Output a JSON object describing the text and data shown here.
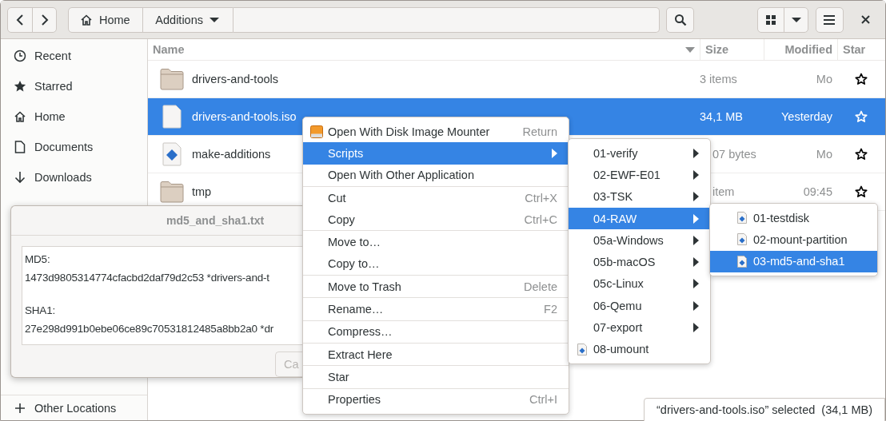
{
  "toolbar": {
    "path": [
      {
        "label": "Home",
        "kind": "home"
      },
      {
        "label": "Additions",
        "kind": "current"
      }
    ]
  },
  "sidebar": {
    "items": [
      {
        "label": "Recent"
      },
      {
        "label": "Starred"
      },
      {
        "label": "Home"
      },
      {
        "label": "Documents"
      },
      {
        "label": "Downloads"
      }
    ],
    "footer": {
      "label": "Other Locations"
    }
  },
  "table": {
    "columns": [
      "Name",
      "Size",
      "Modified",
      "Star"
    ],
    "rows": [
      {
        "name": "drivers-and-tools",
        "kind": "folder",
        "size": "3 items",
        "modified": "Mo",
        "selected": false
      },
      {
        "name": "drivers-and-tools.iso",
        "kind": "file",
        "size": "34,1 MB",
        "modified": "Yesterday",
        "selected": true
      },
      {
        "name": "make-additions",
        "kind": "script",
        "size": "07 bytes",
        "modified": "Mo",
        "selected": false
      },
      {
        "name": "tmp",
        "kind": "folder",
        "size": "item",
        "modified": "09:45",
        "selected": false
      }
    ]
  },
  "dialog": {
    "title": "md5_and_sha1.txt",
    "blocks": [
      {
        "label": "MD5:",
        "value": "1473d9805314774cfacbd2daf79d2c53 *drivers-and-t"
      },
      {
        "label": "SHA1:",
        "value": "27e298d991b0ebe06ce89c70531812485a8bb2a0 *dr"
      }
    ],
    "button": "Ca"
  },
  "context_menu": {
    "groups": [
      [
        {
          "label": "Open With Disk Image Mounter",
          "shortcut": "Return",
          "kind": "app",
          "selected": false
        },
        {
          "label": "Scripts",
          "kind": "submenu",
          "selected": true
        },
        {
          "label": "Open With Other Application",
          "kind": "plain",
          "selected": false
        }
      ],
      [
        {
          "label": "Cut",
          "shortcut": "Ctrl+X",
          "kind": "plain",
          "selected": false
        },
        {
          "label": "Copy",
          "shortcut": "Ctrl+C",
          "kind": "plain",
          "selected": false
        }
      ],
      [
        {
          "label": "Move to…",
          "kind": "plain",
          "selected": false
        },
        {
          "label": "Copy to…",
          "kind": "plain",
          "selected": false
        }
      ],
      [
        {
          "label": "Move to Trash",
          "shortcut": "Delete",
          "kind": "plain",
          "selected": false
        }
      ],
      [
        {
          "label": "Rename…",
          "shortcut": "F2",
          "kind": "plain",
          "selected": false
        }
      ],
      [
        {
          "label": "Compress…",
          "kind": "plain",
          "selected": false
        }
      ],
      [
        {
          "label": "Extract Here",
          "kind": "plain",
          "selected": false
        }
      ],
      [
        {
          "label": "Star",
          "kind": "plain",
          "selected": false
        }
      ],
      [
        {
          "label": "Properties",
          "shortcut": "Ctrl+I",
          "kind": "plain",
          "selected": false
        }
      ]
    ]
  },
  "scripts_menu": {
    "groups": [
      [
        {
          "label": "01-verify",
          "kind": "submenu",
          "selected": false
        },
        {
          "label": "02-EWF-E01",
          "kind": "submenu",
          "selected": false
        },
        {
          "label": "03-TSK",
          "kind": "submenu",
          "selected": false
        },
        {
          "label": "04-RAW",
          "kind": "submenu",
          "selected": true
        },
        {
          "label": "05a-Windows",
          "kind": "submenu",
          "selected": false
        },
        {
          "label": "05b-macOS",
          "kind": "submenu",
          "selected": false
        },
        {
          "label": "05c-Linux",
          "kind": "submenu",
          "selected": false
        },
        {
          "label": "06-Qemu",
          "kind": "submenu",
          "selected": false
        },
        {
          "label": "07-export",
          "kind": "submenu",
          "selected": false
        },
        {
          "label": "08-umount",
          "kind": "script",
          "selected": false
        }
      ]
    ]
  },
  "raw_menu": {
    "groups": [
      [
        {
          "label": "01-testdisk",
          "kind": "script",
          "selected": false
        },
        {
          "label": "02-mount-partition",
          "kind": "script",
          "selected": false
        },
        {
          "label": "03-md5-and-sha1",
          "kind": "script",
          "selected": true
        }
      ]
    ]
  },
  "status_bar": "“drivers-and-tools.iso” selected  (34,1 MB)"
}
